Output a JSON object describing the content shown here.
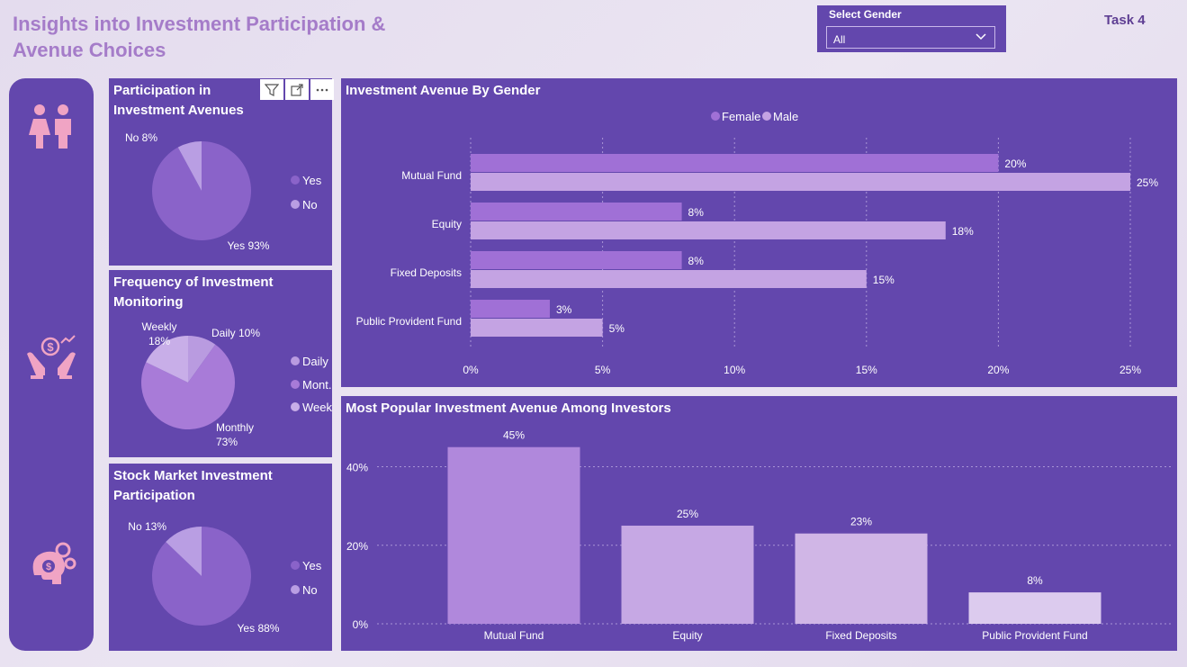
{
  "header": {
    "title": "Insights into Investment Participation & Avenue Choices",
    "task_label": "Task 4"
  },
  "filter": {
    "label": "Select Gender",
    "value": "All"
  },
  "colors": {
    "page_title": "#a57cc9",
    "panel_bg": "#6347ad",
    "female": "#a070d6",
    "male": "#c4a3e3",
    "pie_main": "#8a63c9"
  },
  "chart_data": [
    {
      "id": "participation",
      "type": "pie",
      "title": "Participation in Investment Avenues",
      "labels": [
        "Yes",
        "No"
      ],
      "values": [
        93,
        8
      ],
      "data_labels": [
        "Yes 93%",
        "No 8%"
      ],
      "colors": [
        "#8a63c9",
        "#b99ee3"
      ],
      "legend": [
        "Yes",
        "No"
      ],
      "legend_placement": "right"
    },
    {
      "id": "monitoring",
      "type": "pie",
      "title": "Frequency of Investment Monitoring",
      "labels": [
        "Daily",
        "Monthly",
        "Weekly"
      ],
      "values": [
        10,
        73,
        18
      ],
      "data_labels": [
        "Daily 10%",
        "Monthly 73%",
        "Weekly 18%"
      ],
      "colors": [
        "#b99be0",
        "#a87bd8",
        "#c8aee8"
      ],
      "legend": [
        "Daily",
        "Mont...",
        "Weekly"
      ],
      "legend_placement": "right"
    },
    {
      "id": "stock",
      "type": "pie",
      "title": "Stock Market Investment Participation",
      "labels": [
        "Yes",
        "No"
      ],
      "values": [
        88,
        13
      ],
      "data_labels": [
        "Yes 88%",
        "No 13%"
      ],
      "colors": [
        "#8a63c9",
        "#b99ee3"
      ],
      "legend": [
        "Yes",
        "No"
      ],
      "legend_placement": "right"
    },
    {
      "id": "by_gender",
      "type": "bar",
      "orientation": "horizontal",
      "title": "Investment Avenue By Gender",
      "categories": [
        "Mutual Fund",
        "Equity",
        "Fixed Deposits",
        "Public Provident Fund"
      ],
      "series": [
        {
          "name": "Female",
          "values": [
            20,
            8,
            8,
            3
          ],
          "labels": [
            "20%",
            "8%",
            "8%",
            "3%"
          ]
        },
        {
          "name": "Male",
          "values": [
            25,
            18,
            15,
            5
          ],
          "labels": [
            "25%",
            "18%",
            "15%",
            "5%"
          ]
        }
      ],
      "xticks": [
        "0%",
        "5%",
        "10%",
        "15%",
        "20%",
        "25%"
      ],
      "xlim": [
        0,
        25
      ],
      "legend_placement": "top",
      "grid": true
    },
    {
      "id": "popular",
      "type": "bar",
      "orientation": "vertical",
      "title": "Most Popular Investment Avenue Among Investors",
      "categories": [
        "Mutual Fund",
        "Equity",
        "Fixed Deposits",
        "Public Provident Fund"
      ],
      "values": [
        45,
        25,
        23,
        8
      ],
      "labels": [
        "45%",
        "25%",
        "23%",
        "8%"
      ],
      "colors": [
        "#b088dc",
        "#c6a8e4",
        "#d0b6e6",
        "#dccbee"
      ],
      "yticks": [
        "0%",
        "20%",
        "40%"
      ],
      "ylim": [
        0,
        47
      ],
      "grid": true
    }
  ]
}
